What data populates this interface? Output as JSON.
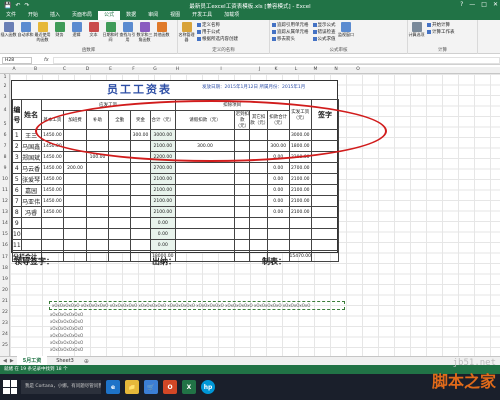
{
  "app": {
    "title": "最新员工excel工资表模板.xls [兼容模式] - Excel",
    "qat": [
      "💾",
      "↶",
      "↷"
    ],
    "window_buttons": [
      "?",
      "—",
      "□",
      "✕"
    ]
  },
  "ribbon_tabs": [
    "文件",
    "开始",
    "插入",
    "页面布局",
    "公式",
    "数据",
    "审阅",
    "视图",
    "开发工具",
    "加载项"
  ],
  "ribbon_tabs_active": "公式",
  "ribbon": {
    "groups": [
      {
        "label": "函数库",
        "buttons": [
          "插入函数",
          "自动求和",
          "最近使用的函数",
          "财务",
          "逻辑",
          "文本",
          "日期和时间",
          "查找与引用",
          "数学和三角函数",
          "其他函数"
        ]
      },
      {
        "label": "定义的名称",
        "buttons": [
          "名称管理器"
        ],
        "small": [
          "定义名称",
          "用于公式",
          "根据所选内容创建"
        ]
      },
      {
        "label": "公式审核",
        "small": [
          "追踪引用单元格",
          "追踪从属单元格",
          "移去箭头",
          "显示公式",
          "错误检查",
          "公式求值"
        ],
        "buttons": [
          "监视窗口"
        ]
      },
      {
        "label": "计算",
        "buttons": [
          "计算选项"
        ],
        "small": [
          "开始计算",
          "计算工作表"
        ]
      }
    ]
  },
  "formula_bar": {
    "name_box": "H28",
    "fx": "fx",
    "value": ""
  },
  "columns": [
    "A",
    "B",
    "C",
    "D",
    "E",
    "F",
    "G",
    "H",
    "I",
    "J",
    "K",
    "L",
    "M",
    "N",
    "O"
  ],
  "rows": [
    "1",
    "2",
    "3",
    "4",
    "5",
    "6",
    "7",
    "8",
    "9",
    "10",
    "11",
    "12",
    "13",
    "14",
    "15",
    "16",
    "17",
    "18",
    "19",
    "20",
    "21",
    "22",
    "23",
    "24",
    "25",
    "26",
    "27",
    "28",
    "29",
    "30"
  ],
  "sheet": {
    "title": "员工工资表",
    "date_label": "发放日期：2015年1月12日  所属月份：2015年1月",
    "headers": {
      "no": "编号",
      "name": "姓名",
      "income_group": "应发工资",
      "deduct_group": "扣除项目",
      "base": "基本工资",
      "overtime": "加班费",
      "allowance": "补助",
      "attendance": "全勤",
      "bonus": "奖金",
      "total": "合计（元）",
      "leave": "请假扣款（元）",
      "late": "迟到扣款（元）",
      "other": "其它扣款（元）",
      "deduct_total": "扣款合计（元）",
      "net": "实发工资（元）",
      "sign": "签字"
    },
    "rows": [
      {
        "no": "1",
        "name": "王三",
        "base": "1450.00",
        "overtime": "",
        "allowance": "",
        "attendance": "",
        "bonus": "300.00",
        "total": "3000.00",
        "leave": "",
        "late": "",
        "other": "",
        "deduct_total": "",
        "net": "3000.00"
      },
      {
        "no": "2",
        "name": "马国鑫",
        "base": "1450.00",
        "overtime": "",
        "allowance": "",
        "attendance": "",
        "bonus": "",
        "total": "2100.00",
        "leave": "300.00",
        "late": "",
        "other": "",
        "deduct_total": "300.00",
        "net": "1800.00"
      },
      {
        "no": "3",
        "name": "郑国斌",
        "base": "1450.00",
        "overtime": "",
        "allowance": "100.00",
        "attendance": "",
        "bonus": "",
        "total": "2200.00",
        "leave": "",
        "late": "",
        "other": "",
        "deduct_total": "0.00",
        "net": "2200.00"
      },
      {
        "no": "4",
        "name": "马云香",
        "base": "1450.00",
        "overtime": "200.00",
        "allowance": "",
        "attendance": "",
        "bonus": "",
        "total": "2700.00",
        "leave": "",
        "late": "",
        "other": "",
        "deduct_total": "0.00",
        "net": "2700.00"
      },
      {
        "no": "5",
        "name": "张爱琴",
        "base": "1450.00",
        "overtime": "",
        "allowance": "",
        "attendance": "",
        "bonus": "",
        "total": "2100.00",
        "leave": "",
        "late": "",
        "other": "",
        "deduct_total": "0.00",
        "net": "2100.00"
      },
      {
        "no": "6",
        "name": "嘉园",
        "base": "1450.00",
        "overtime": "",
        "allowance": "",
        "attendance": "",
        "bonus": "",
        "total": "2100.00",
        "leave": "",
        "late": "",
        "other": "",
        "deduct_total": "0.00",
        "net": "2100.00"
      },
      {
        "no": "7",
        "name": "马亚伟",
        "base": "1450.00",
        "overtime": "",
        "allowance": "",
        "attendance": "",
        "bonus": "",
        "total": "2100.00",
        "leave": "",
        "late": "",
        "other": "",
        "deduct_total": "0.00",
        "net": "2100.00"
      },
      {
        "no": "8",
        "name": "冯睿",
        "base": "1450.00",
        "overtime": "",
        "allowance": "",
        "attendance": "",
        "bonus": "",
        "total": "2100.00",
        "leave": "",
        "late": "",
        "other": "",
        "deduct_total": "0.00",
        "net": "2100.00"
      },
      {
        "no": "9",
        "name": "",
        "base": "",
        "overtime": "",
        "allowance": "",
        "attendance": "",
        "bonus": "",
        "total": "0.00",
        "leave": "",
        "late": "",
        "other": "",
        "deduct_total": "",
        "net": ""
      },
      {
        "no": "10",
        "name": "",
        "base": "",
        "overtime": "",
        "allowance": "",
        "attendance": "",
        "bonus": "",
        "total": "0.00",
        "leave": "",
        "late": "",
        "other": "",
        "deduct_total": "",
        "net": ""
      },
      {
        "no": "11",
        "name": "",
        "base": "",
        "overtime": "",
        "allowance": "",
        "attendance": "",
        "bonus": "",
        "total": "0.00",
        "leave": "",
        "late": "",
        "other": "",
        "deduct_total": "",
        "net": ""
      }
    ],
    "subtotal_label": "分栏合计",
    "subtotal_total": "18000.00",
    "subtotal_net": "15470.00",
    "sign_leader": "领导签字：",
    "sign_cashier": "出纳：",
    "sign_maker": "制表："
  },
  "dashed_note": "xOxOxOxOxO xOxOxOxOxO xOxOxOxOxO xOxOxOxOxO xOxOxOxOxO xOxOxOxOxO xOxOxOxOxO xOxOxOxOxO xOxOxOxOxO",
  "below_notes": [
    "xOxOxOxOxOxO",
    "xOxOxOxOxOxO",
    "xOxOxOxOxOxO",
    "xOxOxOxOxOxO",
    "xOxOxOxOxOxO",
    "xOxOxOxOxOxO"
  ],
  "sheet_tabs": [
    "5月工资",
    "Sheet3"
  ],
  "sheet_tabs_active": "5月工资",
  "status_text": "就绪  在 19 条记录中找到 18 个",
  "taskbar": {
    "search_placeholder": "我是 Cortana，小娜。有问题尽管问我。",
    "icons": [
      "e",
      "📁",
      "🛒",
      "O",
      "X",
      "hp"
    ]
  },
  "watermark": {
    "site": "jb51.net",
    "cn": "脚本之家"
  },
  "colors": {
    "accent": "#217346",
    "title_blue": "#2e4fa6",
    "annotation_red": "#d11c1c"
  }
}
